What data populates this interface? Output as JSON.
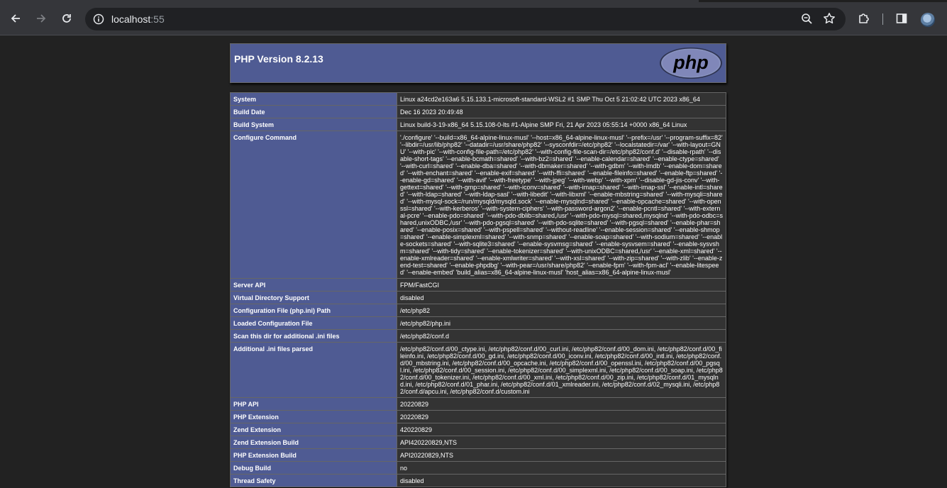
{
  "browser": {
    "url_host": "localhost",
    "url_port": ":55"
  },
  "phpinfo": {
    "title": "PHP Version 8.2.13",
    "logo_text": "php",
    "rows": [
      {
        "key": "System",
        "value": "Linux a24cd2e163a6 5.15.133.1-microsoft-standard-WSL2 #1 SMP Thu Oct 5 21:02:42 UTC 2023 x86_64"
      },
      {
        "key": "Build Date",
        "value": "Dec 16 2023 20:49:48"
      },
      {
        "key": "Build System",
        "value": "Linux build-3-19-x86_64 5.15.108-0-lts #1-Alpine SMP Fri, 21 Apr 2023 05:55:14 +0000 x86_64 Linux"
      },
      {
        "key": "Configure Command",
        "value": "'./configure' '--build=x86_64-alpine-linux-musl' '--host=x86_64-alpine-linux-musl' '--prefix=/usr' '--program-suffix=82' '--libdir=/usr/lib/php82' '--datadir=/usr/share/php82' '--sysconfdir=/etc/php82' '--localstatedir=/var' '--with-layout=GNU' '--with-pic' '--with-config-file-path=/etc/php82' '--with-config-file-scan-dir=/etc/php82/conf.d' '--disable-rpath' '--disable-short-tags' '--enable-bcmath=shared' '--with-bz2=shared' '--enable-calendar=shared' '--enable-ctype=shared' '--with-curl=shared' '--enable-dba=shared' '--with-dbmaker=shared' '--with-gdbm' '--with-lmdb' '--enable-dom=shared' '--with-enchant=shared' '--enable-exif=shared' '--with-ffi=shared' '--enable-fileinfo=shared' '--enable-ftp=shared' '--enable-gd=shared' '--with-avif' '--with-freetype' '--with-jpeg' '--with-webp' '--with-xpm' '--disable-gd-jis-conv' '--with-gettext=shared' '--with-gmp=shared' '--with-iconv=shared' '--with-imap=shared' '--with-imap-ssl' '--enable-intl=shared' '--with-ldap=shared' '--with-ldap-sasl' '--with-libedit' '--with-libxml' '--enable-mbstring=shared' '--with-mysqli=shared' '--with-mysql-sock=/run/mysqld/mysqld.sock' '--enable-mysqlnd=shared' '--enable-opcache=shared' '--with-openssl=shared' '--with-kerberos' '--with-system-ciphers' '--with-password-argon2' '--enable-pcntl=shared' '--with-external-pcre' '--enable-pdo=shared' '--with-pdo-dblib=shared,/usr' '--with-pdo-mysql=shared,mysqlnd' '--with-pdo-odbc=shared,unixODBC,/usr' '--with-pdo-pgsql=shared' '--with-pdo-sqlite=shared' '--with-pgsql=shared' '--enable-phar=shared' '--enable-posix=shared' '--with-pspell=shared' '--without-readline' '--enable-session=shared' '--enable-shmop=shared' '--enable-simplexml=shared' '--with-snmp=shared' '--enable-soap=shared' '--with-sodium=shared' '--enable-sockets=shared' '--with-sqlite3=shared' '--enable-sysvmsg=shared' '--enable-sysvsem=shared' '--enable-sysvshm=shared' '--with-tidy=shared' '--enable-tokenizer=shared' '--with-unixODBC=shared,/usr' '--enable-xml=shared' '--enable-xmlreader=shared' '--enable-xmlwriter=shared' '--with-xsl=shared' '--with-zip=shared' '--with-zlib' '--enable-zend-test=shared' '--enable-phpdbg' '--with-pear=/usr/share/php82' '--enable-fpm' '--with-fpm-acl' '--enable-litespeed' '--enable-embed' 'build_alias=x86_64-alpine-linux-musl' 'host_alias=x86_64-alpine-linux-musl'"
      },
      {
        "key": "Server API",
        "value": "FPM/FastCGI"
      },
      {
        "key": "Virtual Directory Support",
        "value": "disabled"
      },
      {
        "key": "Configuration File (php.ini) Path",
        "value": "/etc/php82"
      },
      {
        "key": "Loaded Configuration File",
        "value": "/etc/php82/php.ini"
      },
      {
        "key": "Scan this dir for additional .ini files",
        "value": "/etc/php82/conf.d"
      },
      {
        "key": "Additional .ini files parsed",
        "value": "/etc/php82/conf.d/00_ctype.ini, /etc/php82/conf.d/00_curl.ini, /etc/php82/conf.d/00_dom.ini, /etc/php82/conf.d/00_fileinfo.ini, /etc/php82/conf.d/00_gd.ini, /etc/php82/conf.d/00_iconv.ini, /etc/php82/conf.d/00_intl.ini, /etc/php82/conf.d/00_mbstring.ini, /etc/php82/conf.d/00_opcache.ini, /etc/php82/conf.d/00_openssl.ini, /etc/php82/conf.d/00_pgsql.ini, /etc/php82/conf.d/00_session.ini, /etc/php82/conf.d/00_simplexml.ini, /etc/php82/conf.d/00_soap.ini, /etc/php82/conf.d/00_tokenizer.ini, /etc/php82/conf.d/00_xml.ini, /etc/php82/conf.d/00_zip.ini, /etc/php82/conf.d/01_mysqlnd.ini, /etc/php82/conf.d/01_phar.ini, /etc/php82/conf.d/01_xmlreader.ini, /etc/php82/conf.d/02_mysqli.ini, /etc/php82/conf.d/apcu.ini, /etc/php82/conf.d/custom.ini"
      },
      {
        "key": "PHP API",
        "value": "20220829"
      },
      {
        "key": "PHP Extension",
        "value": "20220829"
      },
      {
        "key": "Zend Extension",
        "value": "420220829"
      },
      {
        "key": "Zend Extension Build",
        "value": "API420220829,NTS"
      },
      {
        "key": "PHP Extension Build",
        "value": "API20220829,NTS"
      },
      {
        "key": "Debug Build",
        "value": "no"
      },
      {
        "key": "Thread Safety",
        "value": "disabled"
      }
    ]
  }
}
